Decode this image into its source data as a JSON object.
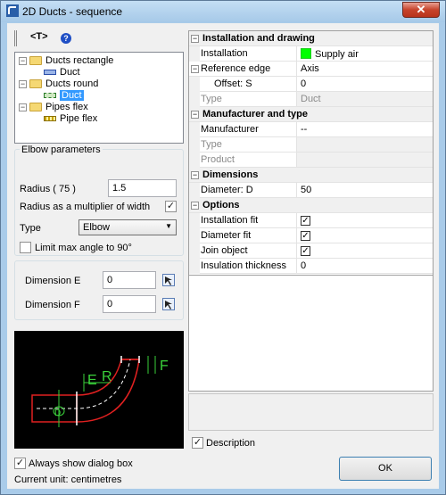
{
  "window": {
    "title": "2D Ducts - sequence",
    "close_glyph": "✕"
  },
  "toolbar": {
    "text_tool_label": "<T>",
    "help_glyph": "?"
  },
  "tree": {
    "items": [
      {
        "label": "Ducts rectangle",
        "type": "folder",
        "toggle": "−"
      },
      {
        "label": "Duct",
        "type": "duct-rect"
      },
      {
        "label": "Ducts round",
        "type": "folder",
        "toggle": "−"
      },
      {
        "label": "Duct",
        "type": "duct-round",
        "selected": true
      },
      {
        "label": "Pipes flex",
        "type": "folder",
        "toggle": "−"
      },
      {
        "label": "Pipe flex",
        "type": "pipe-flex"
      }
    ]
  },
  "elbow": {
    "group_title": "Elbow parameters",
    "radius_label": "Radius ( 75 )",
    "radius_value": "1.5",
    "multiplier_label": "Radius as a multiplier of width",
    "multiplier_checked": "✓",
    "type_label": "Type",
    "type_value": "Elbow",
    "limit_label": "Limit max angle to 90°",
    "limit_checked": ""
  },
  "dimensions_left": {
    "e_label": "Dimension E",
    "e_value": "0",
    "f_label": "Dimension F",
    "f_value": "0"
  },
  "preview_labels": {
    "e": "E",
    "r": "R",
    "f": "F",
    "d": "D"
  },
  "grid": {
    "sections": {
      "installation": "Installation and drawing",
      "manufacturer": "Manufacturer and type",
      "dimensions": "Dimensions",
      "options": "Options"
    },
    "rows": {
      "installation_name": "Installation",
      "installation_value": "Supply air",
      "installation_color": "#00ff00",
      "ref_edge_name": "Reference edge",
      "ref_edge_value": "Axis",
      "offset_name": "Offset: S",
      "offset_value": "0",
      "type1_name": "Type",
      "type1_value": "Duct",
      "manufacturer_name": "Manufacturer",
      "manufacturer_value": "--",
      "type2_name": "Type",
      "type2_value": "",
      "product_name": "Product",
      "product_value": "",
      "diameter_name": "Diameter: D",
      "diameter_value": "50",
      "install_fit_name": "Installation fit",
      "install_fit_value": "✓",
      "diameter_fit_name": "Diameter fit",
      "diameter_fit_value": "✓",
      "join_name": "Join object",
      "join_value": "✓",
      "insulation_name": "Insulation thickness",
      "insulation_value": "0"
    },
    "toggle_glyph": "−"
  },
  "footer": {
    "description_label": "Description",
    "description_checked": "✓",
    "always_show_label": "Always show dialog box",
    "always_show_checked": "✓",
    "unit_label": "Current unit: centimetres",
    "ok_label": "OK"
  }
}
